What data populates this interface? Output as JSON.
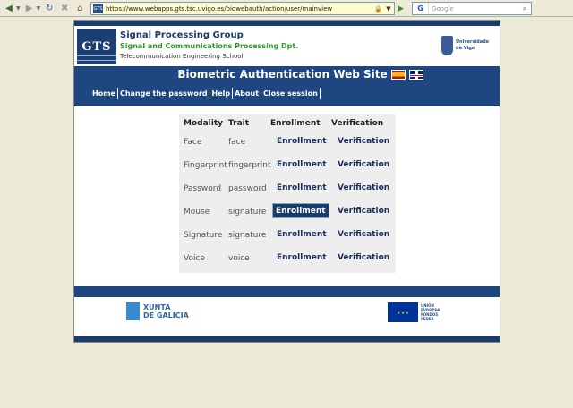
{
  "browser": {
    "url": "https://www.webapps.gts.tsc.uvigo.es/biowebauth/action/user/mainview",
    "search_placeholder": "Google",
    "search_engine_icon": "G",
    "favicon_text": "GTS"
  },
  "header": {
    "logo_text": "GTS",
    "title1": "Signal Processing Group",
    "title2": "Signal and Communications Processing Dpt.",
    "title3": "Telecommunication Engineering School",
    "university_line1": "Universidade",
    "university_line2": "de Vigo"
  },
  "site_title": "Biometric Authentication Web Site",
  "nav": {
    "items": [
      {
        "label": "Home"
      },
      {
        "label": "Change the password"
      },
      {
        "label": "Help"
      },
      {
        "label": "About"
      },
      {
        "label": "Close session"
      }
    ]
  },
  "matrix": {
    "headers": {
      "modality": "Modality",
      "trait": "Trait",
      "enrollment": "Enrollment",
      "verification": "Verification"
    },
    "rows": [
      {
        "modality": "Face",
        "trait": "face",
        "enrollment": "Enrollment",
        "verification": "Verification"
      },
      {
        "modality": "Fingerprint",
        "trait": "fingerprint",
        "enrollment": "Enrollment",
        "verification": "Verification"
      },
      {
        "modality": "Password",
        "trait": "password",
        "enrollment": "Enrollment",
        "verification": "Verification"
      },
      {
        "modality": "Mouse",
        "trait": "signature",
        "enrollment": "Enrollment",
        "verification": "Verification"
      },
      {
        "modality": "Signature",
        "trait": "signature",
        "enrollment": "Enrollment",
        "verification": "Verification"
      },
      {
        "modality": "Voice",
        "trait": "voice",
        "enrollment": "Enrollment",
        "verification": "Verification"
      }
    ],
    "active_row": 3
  },
  "footer": {
    "xunta_line1": "XUNTA",
    "xunta_line2": "DE GALICIA",
    "eu_line1": "UNION",
    "eu_line2": "EUROPEA",
    "eu_line3": "FONDOS",
    "eu_line4": "FEDER"
  },
  "colors": {
    "navy": "#1e4680",
    "green": "#2d9a2d",
    "page_bg": "#ecebd9"
  }
}
